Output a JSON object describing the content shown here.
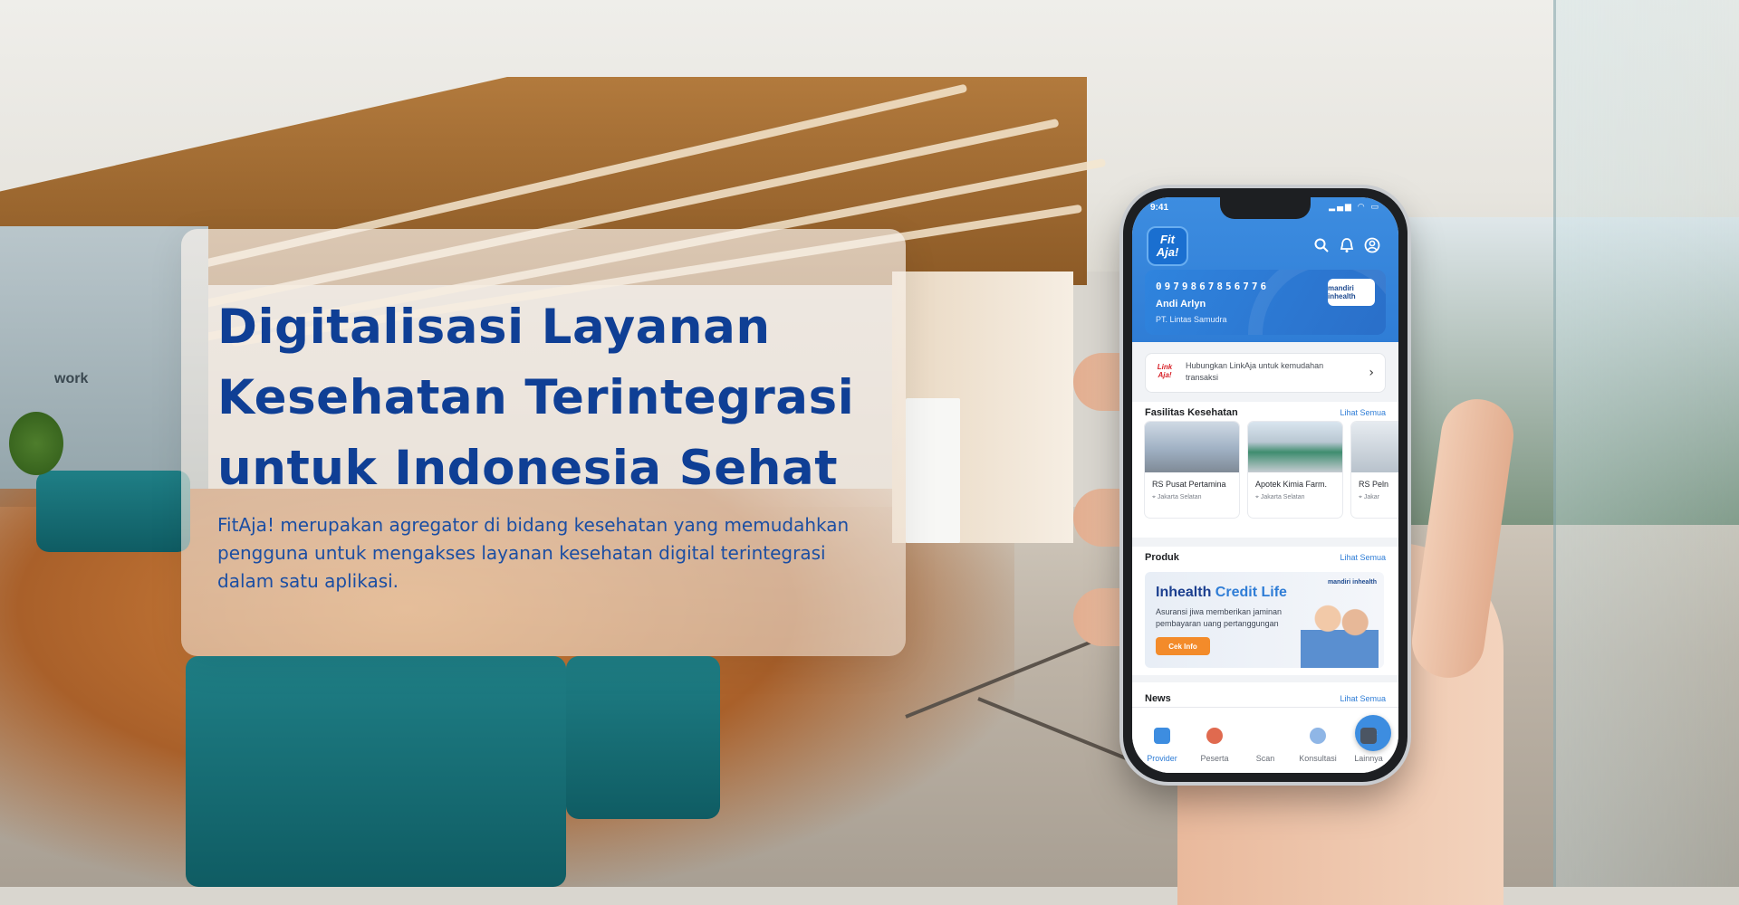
{
  "hero": {
    "title": "Digitalisasi Layanan Kesehatan Terintegrasi untuk Indonesia Sehat",
    "description": "FitAja! merupakan agregator di bidang kesehatan yang memudahkan pengguna untuk mengakses layanan kesehatan digital terintegrasi dalam satu aplikasi."
  },
  "background": {
    "glass_wall_text": "work"
  },
  "phone": {
    "status_time": "9:41",
    "app_logo": "Fit Aja!",
    "icons": [
      "search-icon",
      "bell-icon",
      "profile-icon"
    ],
    "card": {
      "number": "0979867856776",
      "name": "Andi Arlyn",
      "company": "PT. Lintas Samudra",
      "badge": "mandiri inhealth"
    },
    "linkaja": {
      "logo": "Link Aja!",
      "text": "Hubungkan LinkAja untuk kemudahan transaksi"
    },
    "facilities": {
      "title": "Fasilitas Kesehatan",
      "see_all": "Lihat Semua",
      "items": [
        {
          "name": "RS Pusat Pertamina",
          "location": "Jakarta Selatan"
        },
        {
          "name": "Apotek Kimia Farm.",
          "location": "Jakarta Selatan"
        },
        {
          "name": "RS Peln",
          "location": "Jakar"
        }
      ]
    },
    "products": {
      "title": "Produk",
      "see_all": "Lihat Semua",
      "promo": {
        "title_part1": "Inhealth",
        "title_part2": "Credit Life",
        "subtitle": "Asuransi jiwa memberikan jaminan pembayaran uang pertanggungan",
        "button": "Cek Info",
        "badge": "mandiri inhealth"
      }
    },
    "news": {
      "title": "News",
      "see_all": "Lihat Semua"
    },
    "tabs": [
      {
        "label": "Provider",
        "icon": "hospital-icon",
        "active": true
      },
      {
        "label": "Peserta",
        "icon": "person-icon",
        "active": false
      },
      {
        "label": "Scan",
        "icon": "qr-scan-icon",
        "active": false
      },
      {
        "label": "Konsultasi",
        "icon": "doctor-icon",
        "active": false
      },
      {
        "label": "Lainnya",
        "icon": "grid-icon",
        "active": false
      }
    ]
  },
  "colors": {
    "brand_blue": "#0f3f95",
    "app_blue": "#2f7dd6",
    "accent_orange": "#f38b2a"
  }
}
